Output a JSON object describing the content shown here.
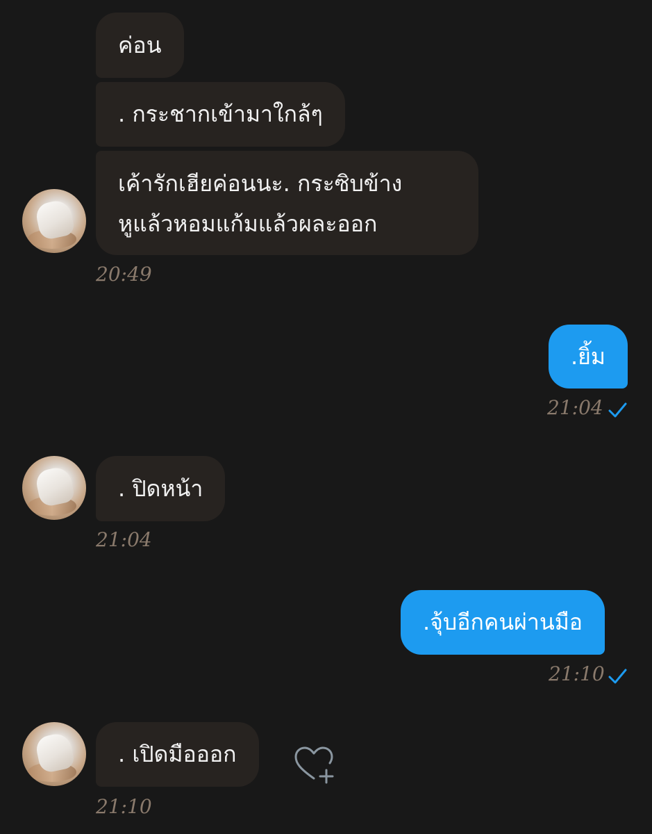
{
  "messages": {
    "m1": {
      "text": "ค่อน"
    },
    "m2": {
      "text": ". กระชากเข้ามาใกล้ๆ"
    },
    "m3": {
      "line1": "เค้ารักเฮียค่อนนะ. กระซิบข้าง",
      "line2": "หูแล้วหอมแก้มแล้วผละออก"
    },
    "t1": "20:49",
    "m4": {
      "text": ".ยิ้ม"
    },
    "t2": "21:04",
    "m5": {
      "text": ". ปิดหน้า"
    },
    "t3": "21:04",
    "m6": {
      "text": ".จุ้บอีกคนผ่านมือ"
    },
    "t4": "21:10",
    "m7": {
      "text": ". เปิดมือออก"
    },
    "t5": "21:10"
  },
  "icons": {
    "read_receipt": "check-icon",
    "reaction": "heart-plus-icon"
  },
  "colors": {
    "background": "#181818",
    "incoming_bubble": "#272320",
    "outgoing_bubble": "#1d9bf0",
    "timestamp": "#8a7a6c",
    "checkmark": "#1d9bf0",
    "heart_icon": "#8a96a0"
  }
}
